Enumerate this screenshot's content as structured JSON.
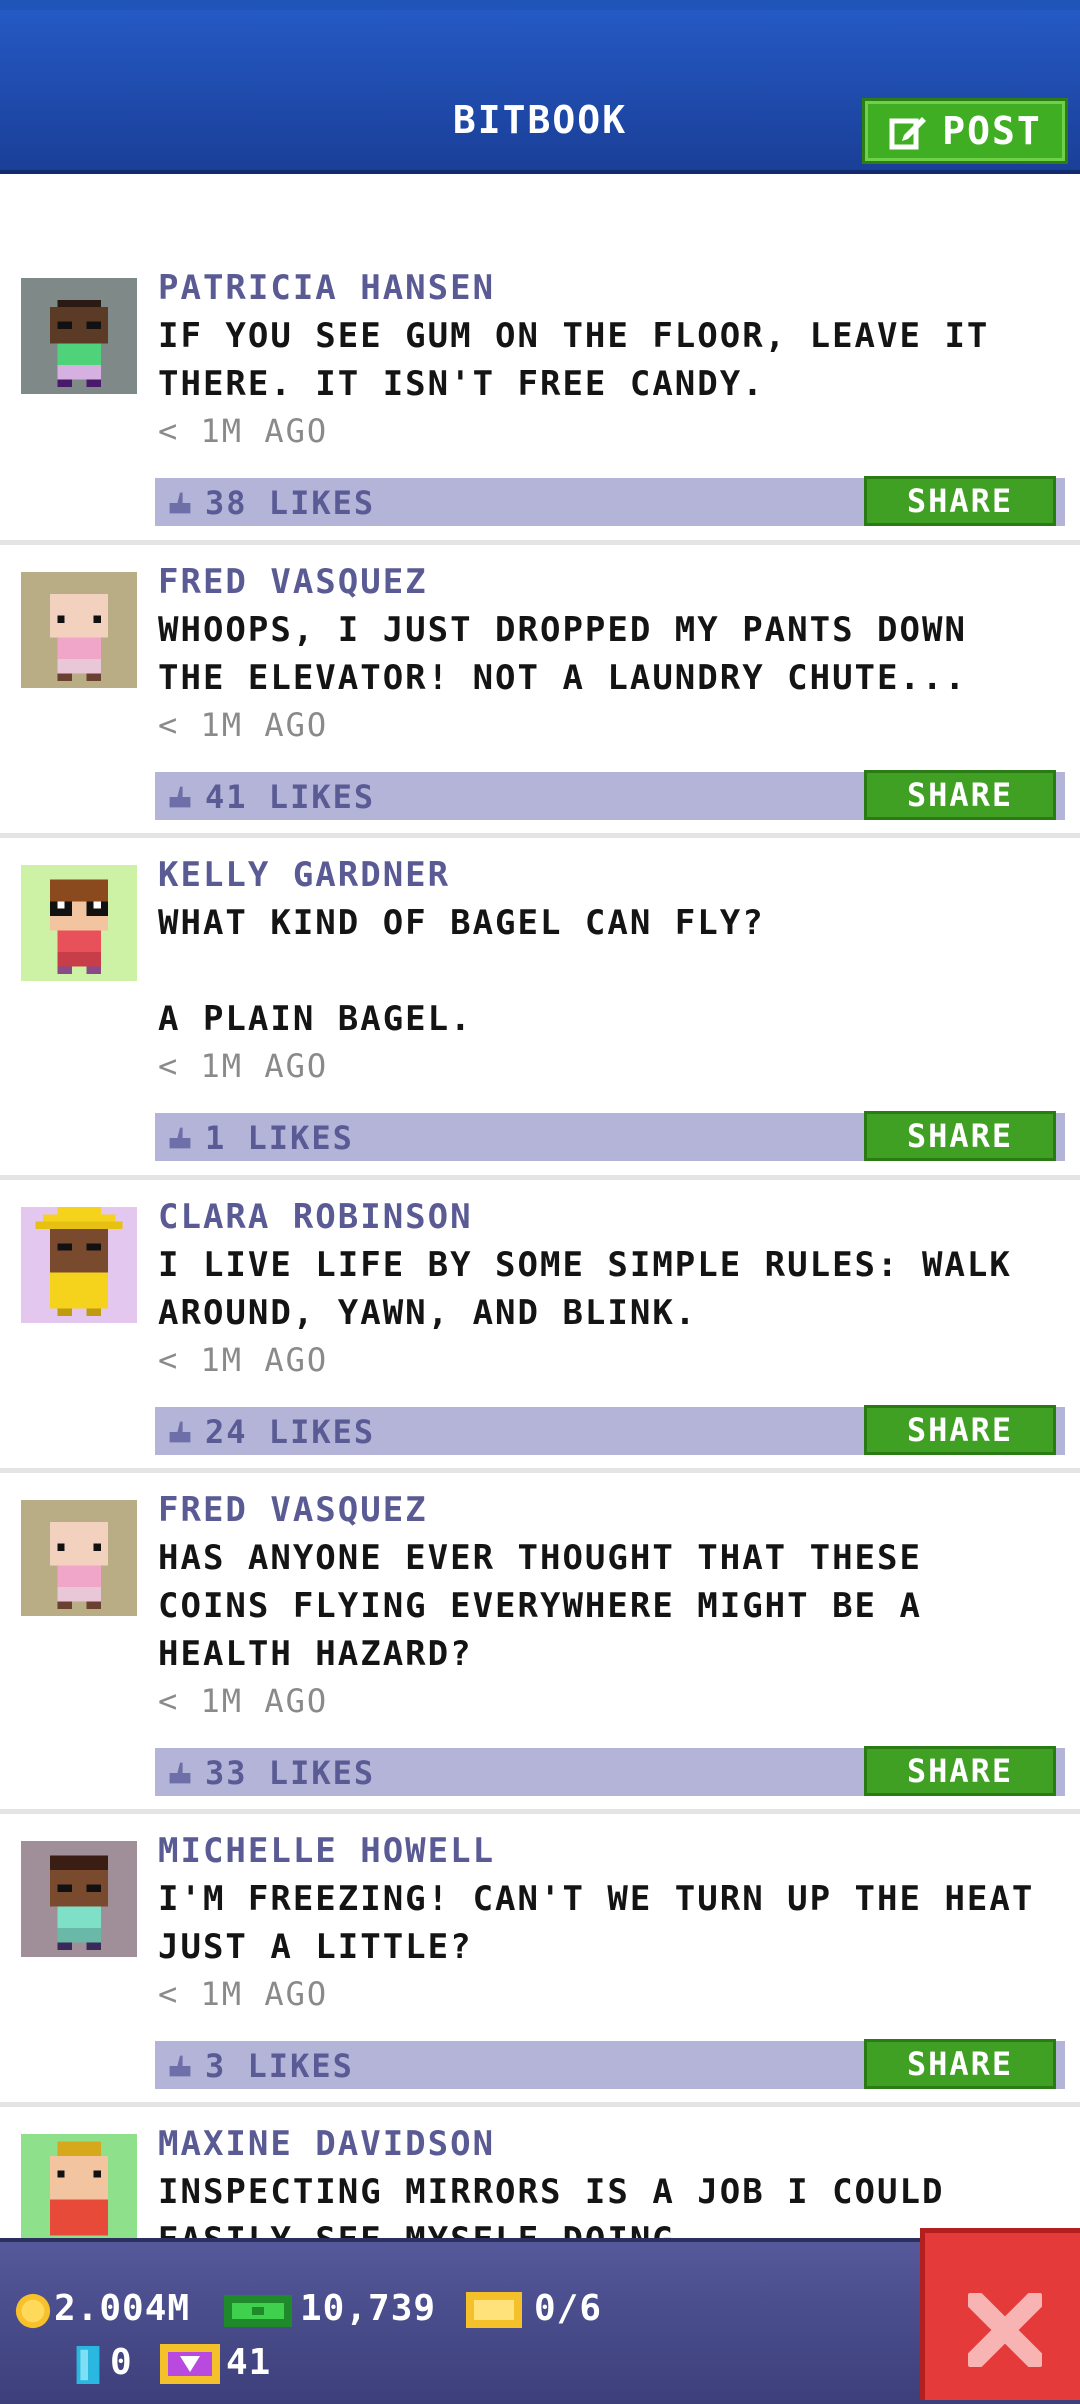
{
  "header": {
    "title": "BITBOOK",
    "post_label": "POST"
  },
  "posts": [
    {
      "author": "PATRICIA HANSEN",
      "text": "IF YOU SEE GUM ON THE FLOOR, LEAVE IT\nTHERE. IT ISN'T FREE CANDY.",
      "time": "< 1M AGO",
      "likes": "38 LIKES",
      "share": "SHARE",
      "avatar_bg": "#7f8a88"
    },
    {
      "author": "FRED VASQUEZ",
      "text": "WHOOPS, I JUST DROPPED MY PANTS DOWN\nTHE ELEVATOR! NOT A LAUNDRY CHUTE...",
      "time": "< 1M AGO",
      "likes": "41 LIKES",
      "share": "SHARE",
      "avatar_bg": "#b8ad85"
    },
    {
      "author": "KELLY GARDNER",
      "text": "WHAT KIND OF BAGEL CAN FLY?\n\nA PLAIN BAGEL.",
      "time": "< 1M AGO",
      "likes": "1 LIKES",
      "share": "SHARE",
      "avatar_bg": "#cdf2a5"
    },
    {
      "author": "CLARA ROBINSON",
      "text": "I LIVE LIFE BY SOME SIMPLE RULES: WALK\nAROUND, YAWN, AND BLINK.",
      "time": "< 1M AGO",
      "likes": "24 LIKES",
      "share": "SHARE",
      "avatar_bg": "#e4c7ef"
    },
    {
      "author": "FRED VASQUEZ",
      "text": "HAS ANYONE EVER THOUGHT THAT THESE\nCOINS FLYING EVERYWHERE MIGHT BE A\nHEALTH HAZARD?",
      "time": "< 1M AGO",
      "likes": "33 LIKES",
      "share": "SHARE",
      "avatar_bg": "#b8ad85"
    },
    {
      "author": "MICHELLE HOWELL",
      "text": "I'M FREEZING! CAN'T WE TURN UP THE HEAT\nJUST A LITTLE?",
      "time": "< 1M AGO",
      "likes": "3 LIKES",
      "share": "SHARE",
      "avatar_bg": "#a08f99"
    },
    {
      "author": "MAXINE DAVIDSON",
      "text": "INSPECTING MIRRORS IS A JOB I COULD\nEASILY SEE MYSELF DOING.",
      "time": "",
      "likes": "",
      "share": "",
      "avatar_bg": "#8ee08a"
    }
  ],
  "stats": {
    "coins": "2.004M",
    "bux": "10,739",
    "tickets": "0/6",
    "blue_items": "0",
    "vip": "41"
  },
  "colors": {
    "header": "#1f4fb3",
    "post_button": "#3fae22",
    "share": "#3fa023",
    "likes_bar": "#b3b4d8",
    "author": "#5a5a94",
    "close": "#e53a3a"
  }
}
